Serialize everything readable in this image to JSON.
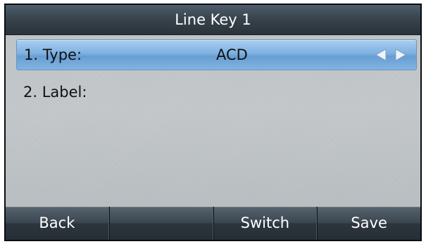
{
  "title": "Line Key 1",
  "rows": [
    {
      "label": "1. Type:",
      "value": "ACD",
      "selected": true
    },
    {
      "label": "2. Label:",
      "value": "",
      "selected": false
    }
  ],
  "icons": {
    "prev": "arrow-left-icon",
    "next": "arrow-right-icon"
  },
  "softkeys": [
    "Back",
    "",
    "Switch",
    "Save"
  ],
  "colors": {
    "selection": "#7eb1e0",
    "title_bar": "#36424c",
    "softkey": "#3a4650",
    "arrow": "#eef4fa"
  }
}
